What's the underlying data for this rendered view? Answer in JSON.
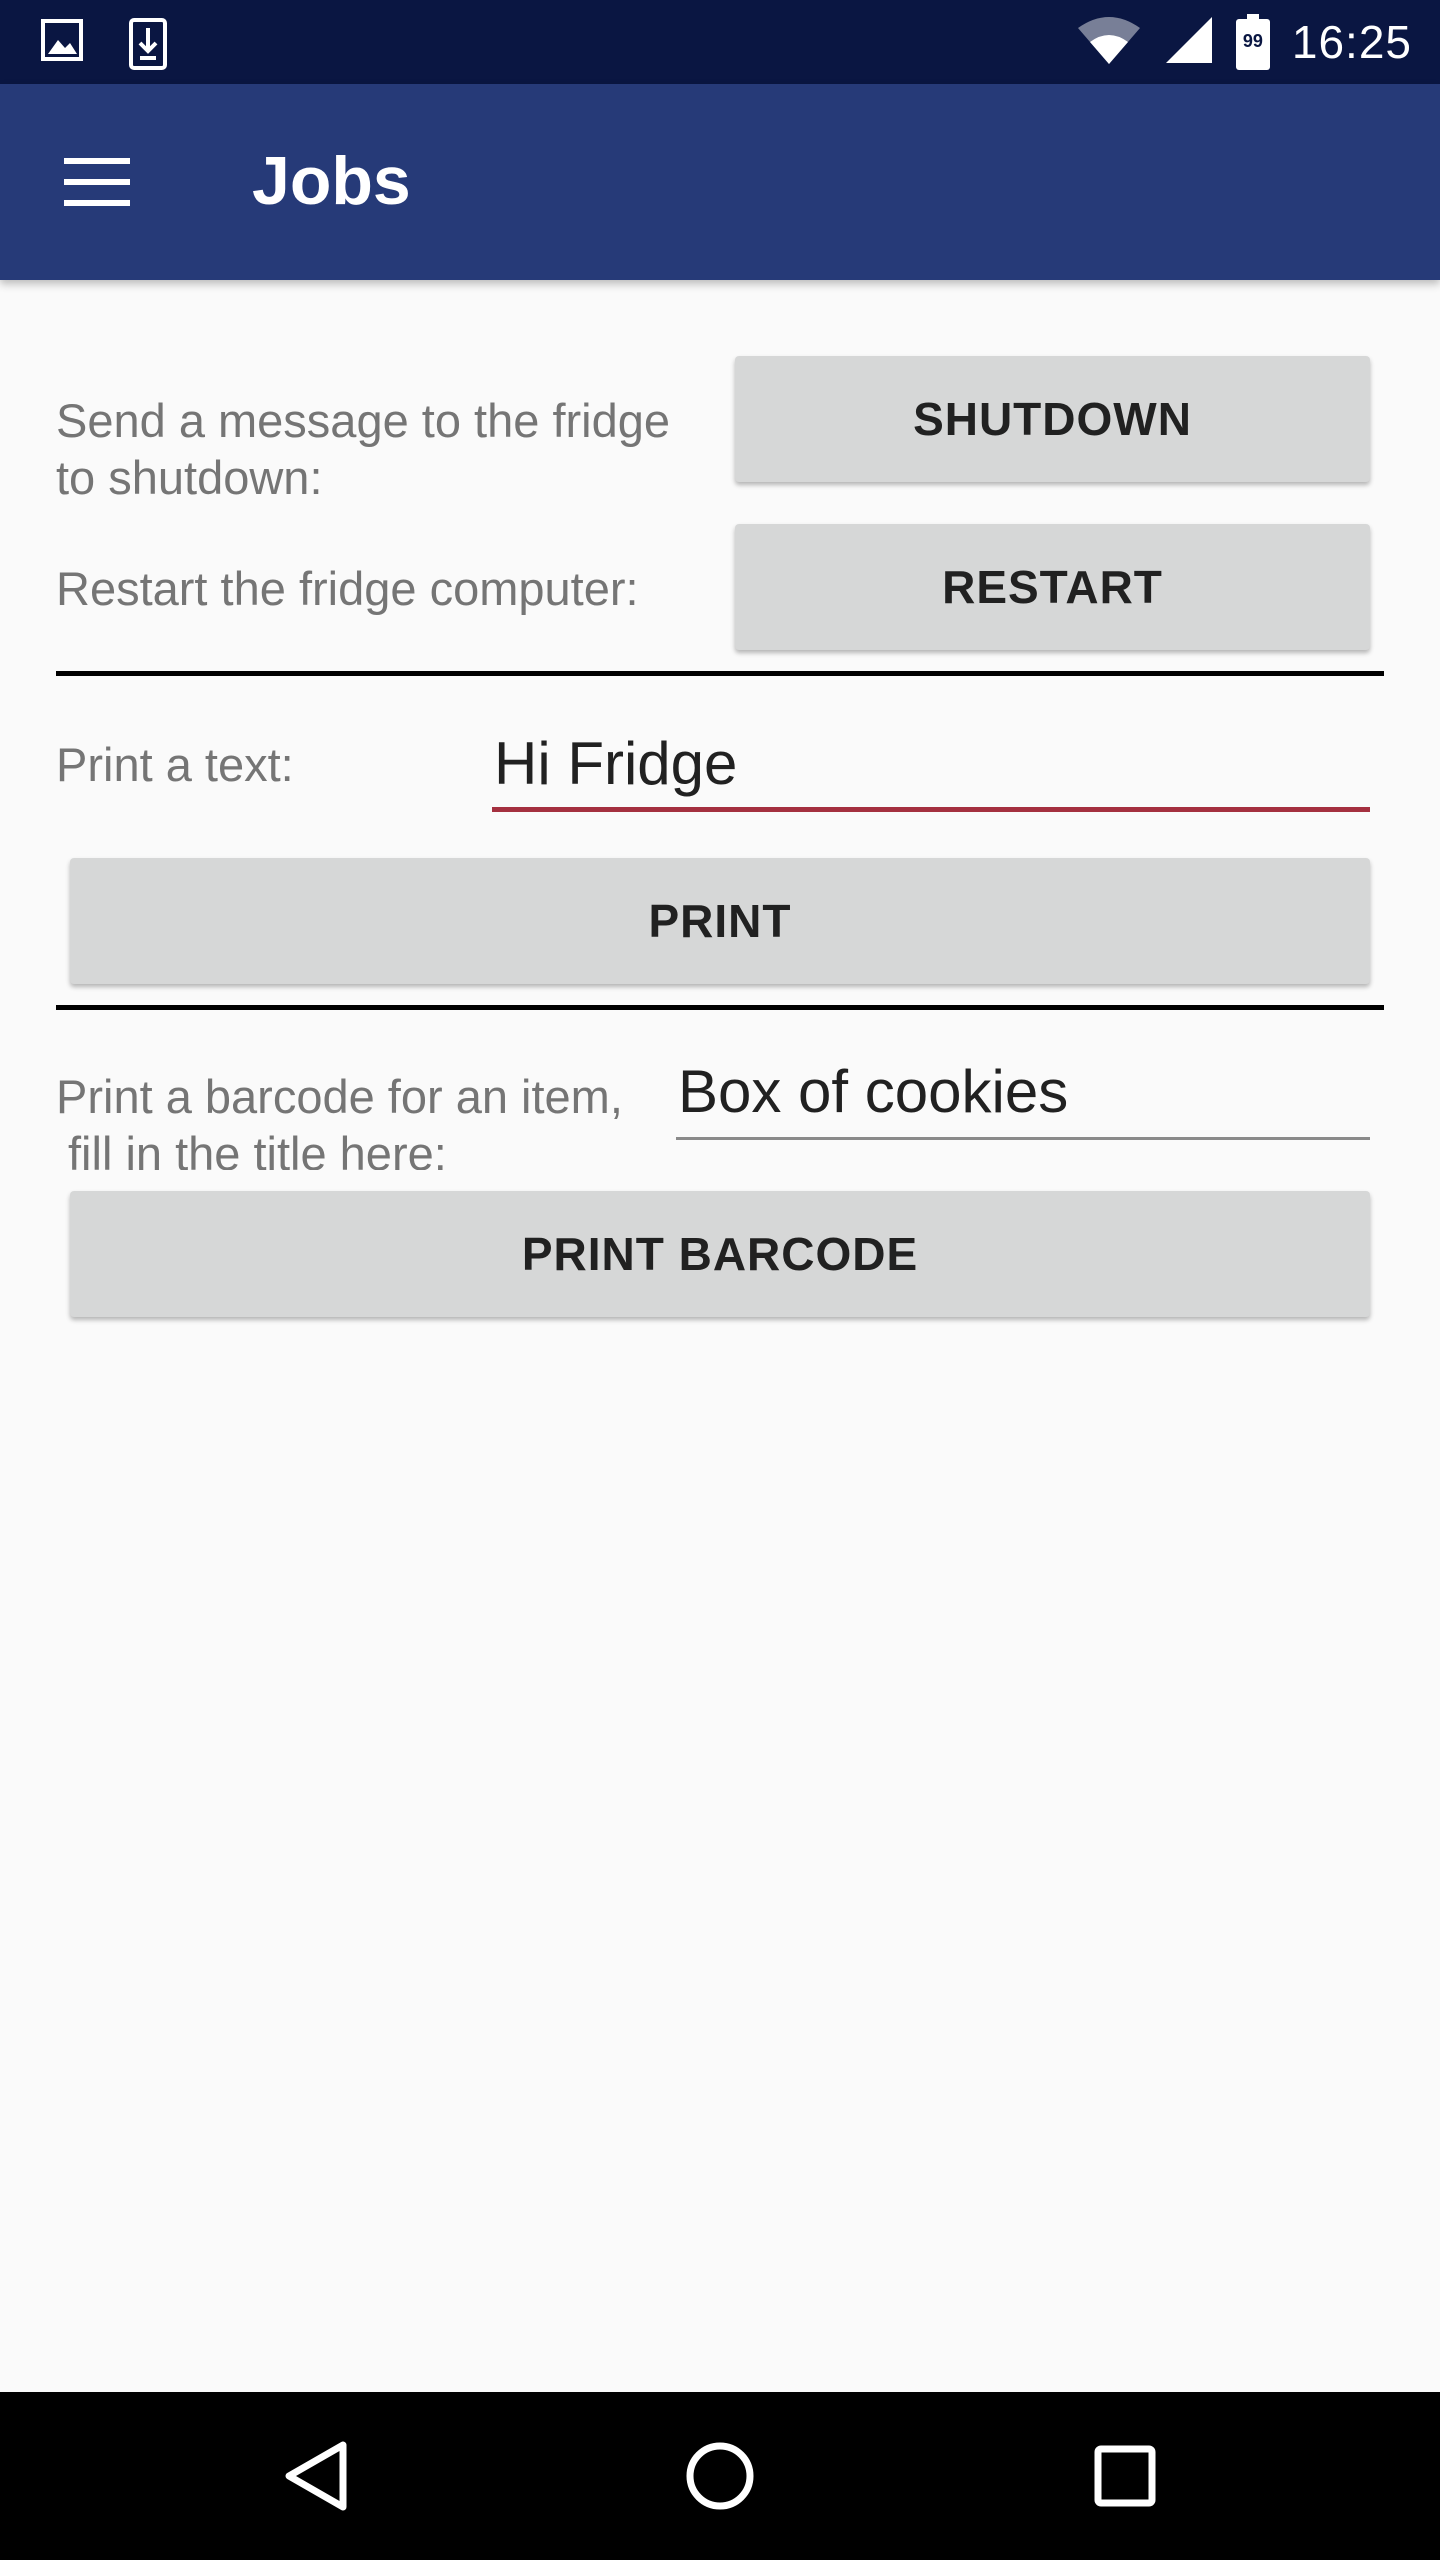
{
  "status_bar": {
    "time": "16:25",
    "battery_level": "99",
    "icons": [
      "image-notification-icon",
      "download-notification-icon",
      "wifi-icon",
      "cell-signal-icon",
      "battery-icon"
    ]
  },
  "app_bar": {
    "title": "Jobs",
    "menu_icon": "hamburger-menu-icon"
  },
  "shutdown": {
    "label_line1": "Send a message to the fridge",
    "label_line2": "to shutdown:",
    "button_label": "SHUTDOWN"
  },
  "restart": {
    "label": "Restart the fridge computer:",
    "button_label": "RESTART"
  },
  "print_text": {
    "label": "Print a text:",
    "input_value": "Hi Fridge",
    "button_label": "PRINT"
  },
  "print_barcode": {
    "label_line1": "Print a barcode for an item,",
    "label_line2": "fill in the title here:",
    "input_value": "Box of cookies",
    "button_label": "PRINT BARCODE"
  },
  "nav_bar": {
    "back_icon": "back-triangle-icon",
    "home_icon": "home-circle-icon",
    "recents_icon": "recents-square-icon"
  },
  "colors": {
    "status_bar": "#0a1642",
    "app_bar": "#263a78",
    "background": "#fafafa",
    "button": "#d6d7d7",
    "focused_underline": "#a4303f",
    "label_text": "#757575",
    "nav_bar": "#000000"
  }
}
